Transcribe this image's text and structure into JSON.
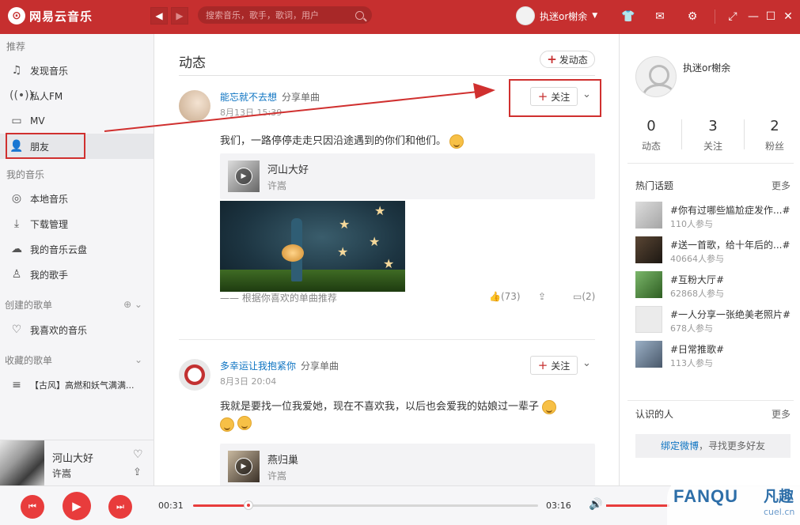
{
  "app": {
    "title": "网易云音乐"
  },
  "search": {
    "placeholder": "搜索音乐，歌手，歌词，用户"
  },
  "user": {
    "name": "执迷or榭余"
  },
  "sidebar": {
    "sections": [
      {
        "title": "推荐",
        "items": [
          {
            "label": "发现音乐",
            "icon": "music-note-icon"
          },
          {
            "label": "私人FM",
            "icon": "radio-icon"
          },
          {
            "label": "MV",
            "icon": "tv-icon"
          },
          {
            "label": "朋友",
            "icon": "friends-icon",
            "active": true
          }
        ]
      },
      {
        "title": "我的音乐",
        "items": [
          {
            "label": "本地音乐",
            "icon": "disc-icon"
          },
          {
            "label": "下载管理",
            "icon": "download-icon"
          },
          {
            "label": "我的音乐云盘",
            "icon": "cloud-icon"
          },
          {
            "label": "我的歌手",
            "icon": "singer-icon"
          }
        ]
      },
      {
        "title": "创建的歌单",
        "items": [
          {
            "label": "我喜欢的音乐",
            "icon": "heart-icon"
          }
        ]
      },
      {
        "title": "收藏的歌单",
        "items": [
          {
            "label": "【古风】高燃和妖气满满...",
            "icon": "playlist-icon"
          }
        ]
      }
    ]
  },
  "now_playing": {
    "title": "河山大好",
    "artist": "许嵩"
  },
  "main": {
    "title": "动态",
    "post_button": "发动态",
    "follow_label": "关注",
    "posts": [
      {
        "user": "能忘就不去想",
        "action": "分享单曲",
        "time": "8月13日 15:39",
        "text": "我们，一路停停走走只因沿途遇到的你们和他们。",
        "song": {
          "title": "河山大好",
          "artist": "许嵩"
        },
        "rec": "—— 根据你喜欢的单曲推荐",
        "likes": "(73)",
        "comments": "(2)"
      },
      {
        "user": "多幸运让我抱紧你",
        "action": "分享单曲",
        "time": "8月3日 20:04",
        "text": "我就是要找一位我爱她，现在不喜欢我，以后也会爱我的姑娘过一辈子",
        "song": {
          "title": "燕归巢",
          "artist": "许嵩"
        }
      }
    ]
  },
  "right": {
    "name": "执迷or榭余",
    "stats": [
      {
        "n": "0",
        "l": "动态"
      },
      {
        "n": "3",
        "l": "关注"
      },
      {
        "n": "2",
        "l": "粉丝"
      }
    ],
    "hot_topics_title": "热门话题",
    "more": "更多",
    "topics": [
      {
        "title": "#你有过哪些尴尬症发作...#",
        "count": "110人参与"
      },
      {
        "title": "#送一首歌，给十年后的...#",
        "count": "40664人参与"
      },
      {
        "title": "#互粉大厅#",
        "count": "62868人参与"
      },
      {
        "title": "#一人分享一张绝美老照片#",
        "count": "678人参与"
      },
      {
        "title": "#日常推歌#",
        "count": "113人参与"
      }
    ],
    "people_title": "认识的人",
    "weibo_bind": "绑定微博",
    "weibo_rest": "，寻找更多好友"
  },
  "player": {
    "current": "00:31",
    "total": "03:16",
    "progress": 0.16,
    "volume": 1.0
  },
  "watermark": {
    "brand": "FANQU",
    "cn": "凡趣",
    "site": "cuel.cn"
  }
}
